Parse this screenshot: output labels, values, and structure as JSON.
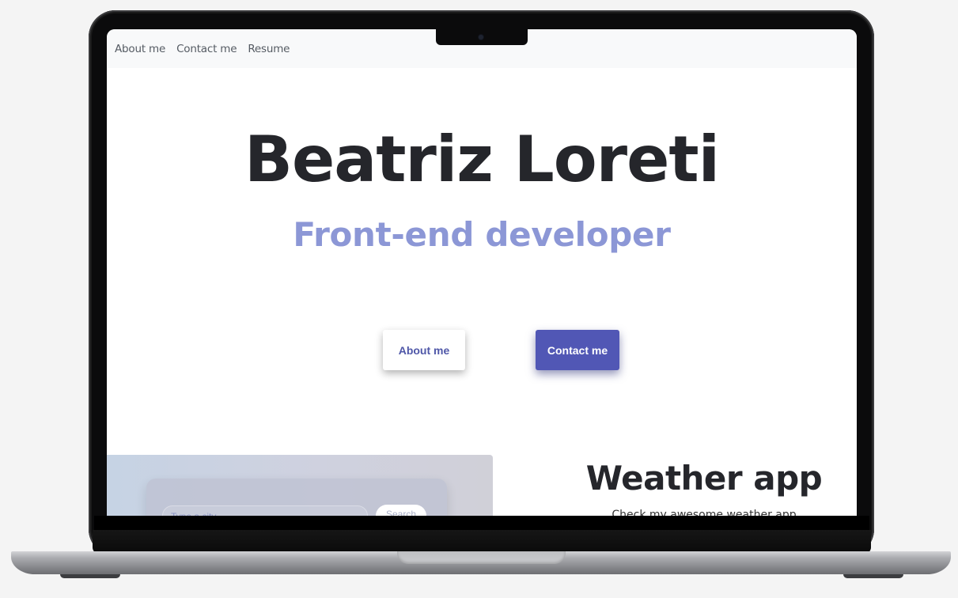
{
  "nav": {
    "items": [
      "About me",
      "Contact me",
      "Resume"
    ]
  },
  "hero": {
    "title": "Beatriz Loreti",
    "subtitle": "Front-end developer",
    "about_button": "About me",
    "contact_button": "Contact me"
  },
  "project": {
    "title": "Weather app",
    "description": "Check my awesome weather app",
    "input_placeholder": "Type a city",
    "search_button": "Search"
  },
  "colors": {
    "primary": "#5157b5",
    "subtitle": "#8c97d6",
    "title": "#25262b",
    "navbar_bg": "#f8f9fa"
  }
}
